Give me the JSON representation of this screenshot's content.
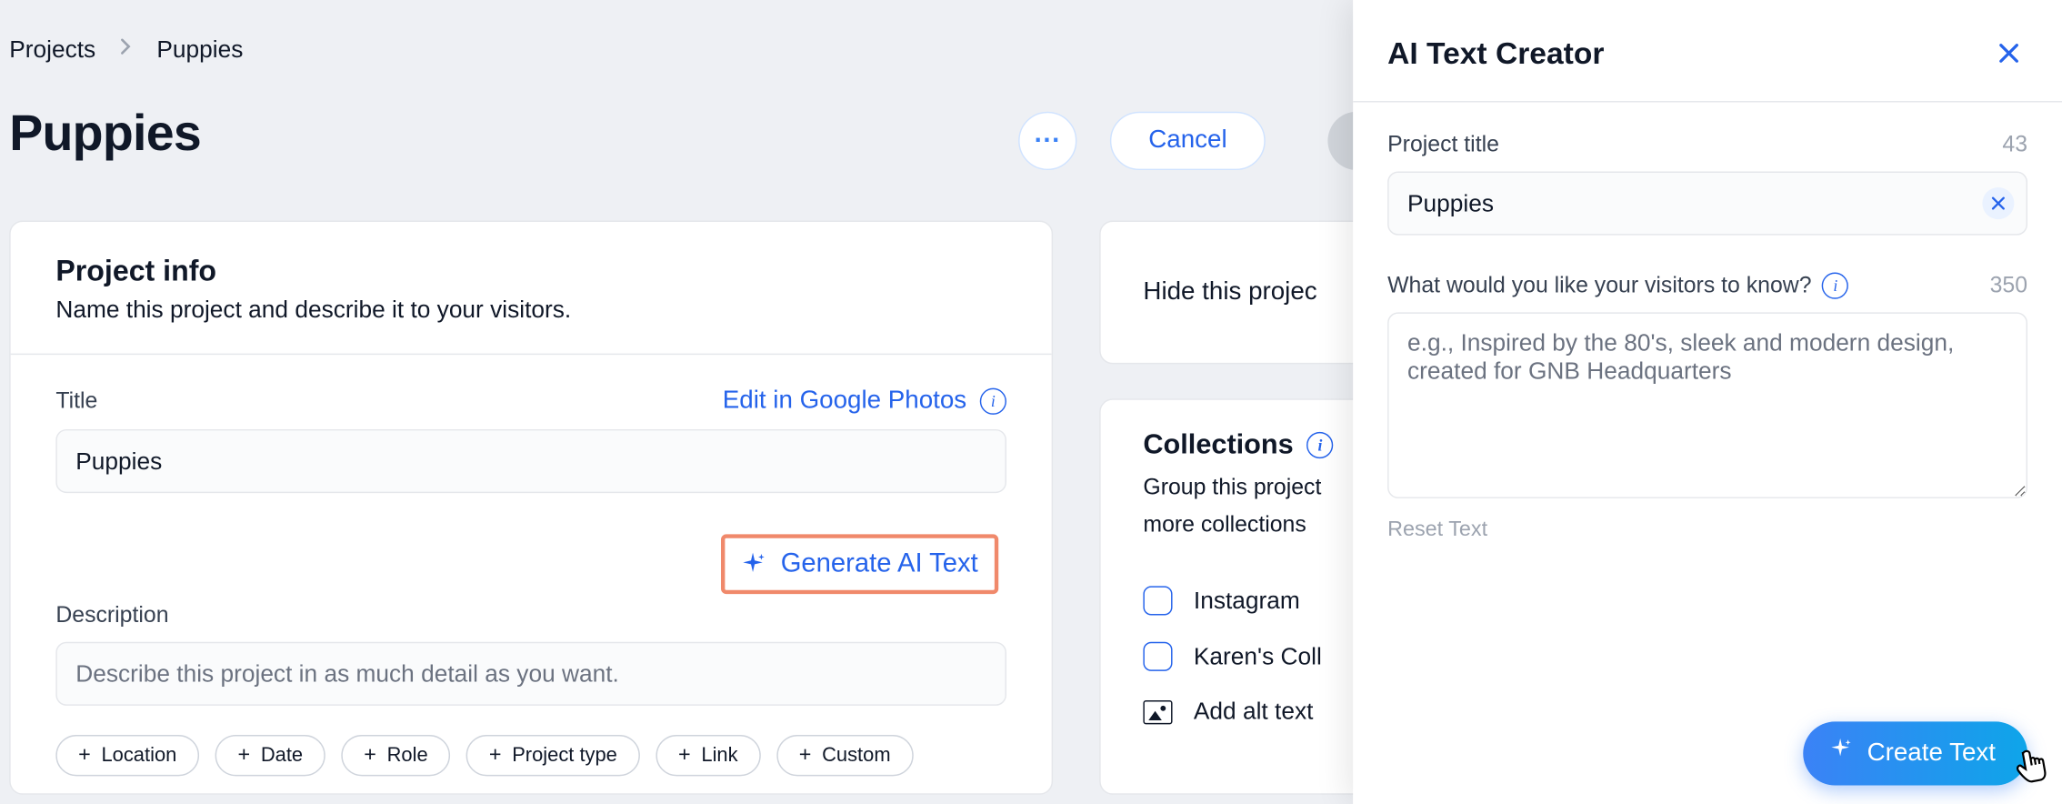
{
  "breadcrumb": {
    "root": "Projects",
    "current": "Puppies"
  },
  "page": {
    "title": "Puppies"
  },
  "actions": {
    "more": "···",
    "cancel": "Cancel"
  },
  "projectInfo": {
    "heading": "Project info",
    "subheading": "Name this project and describe it to your visitors.",
    "titleLabel": "Title",
    "editPhotos": "Edit in Google Photos",
    "titleValue": "Puppies",
    "generate": "Generate AI Text",
    "descLabel": "Description",
    "descPlaceholder": "Describe this project in as much detail as you want.",
    "chips": [
      "Location",
      "Date",
      "Role",
      "Project type",
      "Link",
      "Custom"
    ]
  },
  "hideCard": {
    "text": "Hide this projec"
  },
  "collections": {
    "heading": "Collections",
    "sub1": "Group this project",
    "sub2": "more collections",
    "items": [
      "Instagram",
      "Karen's Coll"
    ],
    "alt": "Add alt text"
  },
  "panel": {
    "title": "AI Text Creator",
    "projectTitleLabel": "Project title",
    "projectTitleCount": "43",
    "projectTitleValue": "Puppies",
    "promptLabel": "What would you like your visitors to know?",
    "promptCount": "350",
    "promptPlaceholder": "e.g., Inspired by the 80's, sleek and modern design, created for GNB Headquarters",
    "reset": "Reset Text",
    "createBtn": "Create Text"
  }
}
